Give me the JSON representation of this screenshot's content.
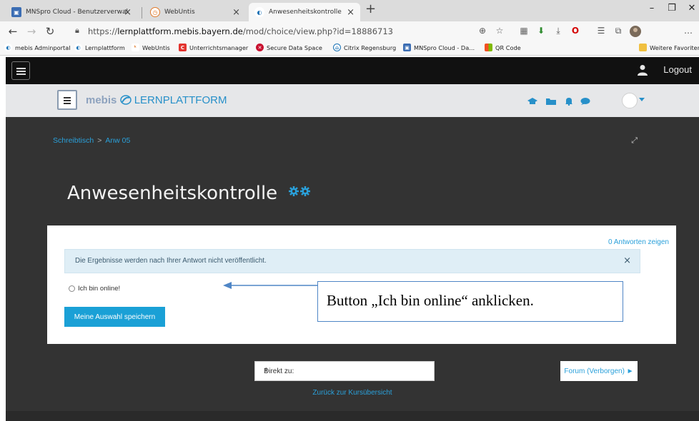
{
  "browser": {
    "tabs": [
      {
        "title": "MNSpro Cloud - Benutzerverwal",
        "active": false
      },
      {
        "title": "WebUntis",
        "active": false
      },
      {
        "title": "Anwesenheitskontrolle",
        "active": true
      }
    ],
    "new_tab": "+",
    "window_controls": {
      "minimize": "–",
      "maximize": "❐",
      "close": "✕"
    },
    "nav": {
      "back": "←",
      "forward": "→",
      "refresh": "↻"
    },
    "url_prefix": "https://",
    "url_host": "lernplattform.mebis.bayern.de",
    "url_path": "/mod/choice/view.php?id=18886713",
    "favorites": [
      "mebis Adminportal",
      "Lernplattform",
      "WebUntis",
      "Unterrichtsmanager",
      "Secure Data Space",
      "Citrix Regensburg",
      "MNSpro Cloud - Da...",
      "QR Code"
    ],
    "other_favorites": "Weitere Favoriten"
  },
  "topnav": {
    "logout": "Logout"
  },
  "header": {
    "logo_mebis": "mebis",
    "logo_lernplattform": "LERNPLATTFORM"
  },
  "breadcrumb": {
    "home": "Schreibtisch",
    "separator": ">",
    "current": "Anw 05"
  },
  "page": {
    "title": "Anwesenheitskontrolle"
  },
  "card": {
    "show_responses": "0 Antworten zeigen",
    "alert_text": "Die Ergebnisse werden nach Ihrer Antwort nicht veröffentlicht.",
    "alert_close": "×",
    "option_label": "Ich bin online!",
    "save_button": "Meine Auswahl speichern",
    "callout_text": "Button „Ich bin online“ anklicken."
  },
  "footer": {
    "jump_to": "Direkt zu:",
    "forum_button": "Forum (Verborgen) ►",
    "back_link": "Zurück zur Kursübersicht"
  },
  "colors": {
    "accent": "#1aa0d6",
    "link": "#2aa0da",
    "page_dark": "#333333",
    "nav_dark": "#111111",
    "alert_bg": "#dfeef6",
    "callout_border": "#4f86c6"
  }
}
